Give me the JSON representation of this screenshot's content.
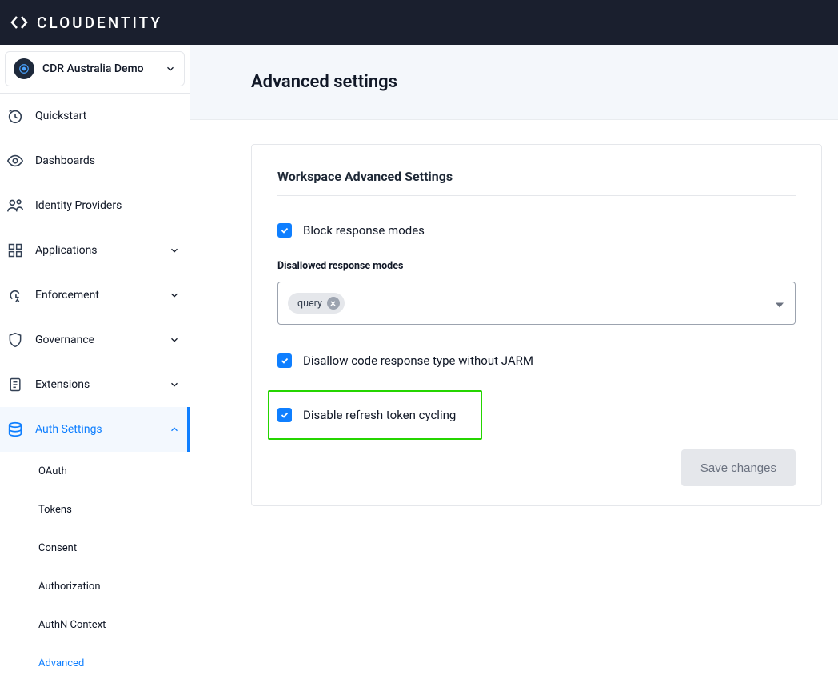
{
  "brand": "CLOUDENTITY",
  "workspace": {
    "name": "CDR Australia Demo"
  },
  "nav": {
    "quickstart": "Quickstart",
    "dashboards": "Dashboards",
    "identity_providers": "Identity Providers",
    "applications": "Applications",
    "enforcement": "Enforcement",
    "governance": "Governance",
    "extensions": "Extensions",
    "auth_settings": "Auth Settings"
  },
  "subnav": {
    "oauth": "OAuth",
    "tokens": "Tokens",
    "consent": "Consent",
    "authorization": "Authorization",
    "authn_context": "AuthN Context",
    "advanced": "Advanced"
  },
  "page": {
    "title": "Advanced settings",
    "card_title": "Workspace Advanced Settings",
    "block_response_modes": "Block response modes",
    "disallowed_label": "Disallowed response modes",
    "chip_query": "query",
    "disallow_jarm": "Disallow code response type without JARM",
    "disable_refresh": "Disable refresh token cycling",
    "save": "Save changes"
  }
}
